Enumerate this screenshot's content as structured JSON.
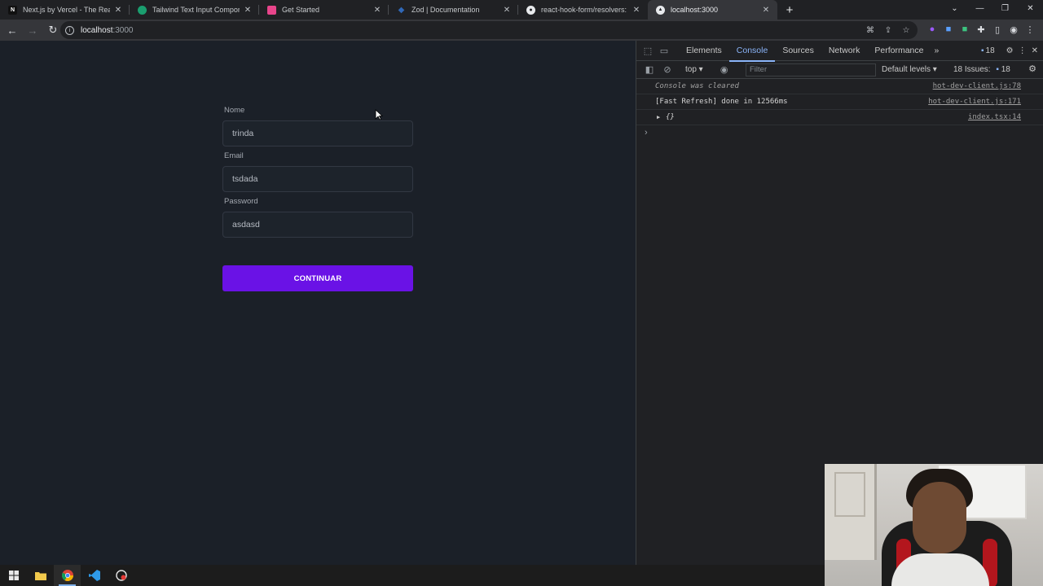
{
  "browser": {
    "tabs": [
      {
        "title": "Next.js by Vercel - The React Framework",
        "favicon": "N",
        "favicon_color": "#111111",
        "active": false
      },
      {
        "title": "Tailwind Text Input Components",
        "favicon": "",
        "favicon_color": "#1a9e6f",
        "active": false
      },
      {
        "title": "Get Started",
        "favicon": "",
        "favicon_color": "#e8458b",
        "active": false
      },
      {
        "title": "Zod | Documentation",
        "favicon": "",
        "favicon_color": "#3068b7",
        "active": false
      },
      {
        "title": "react-hook-form/resolvers: ▣ V",
        "favicon": "",
        "favicon_color": "#e8eaed",
        "active": false
      },
      {
        "title": "localhost:3000",
        "favicon": "▲",
        "favicon_color": "#202124",
        "active": true
      }
    ],
    "new_tab": "+",
    "url_host": "localhost",
    "url_port": ":3000"
  },
  "form": {
    "fields": [
      {
        "label": "Nome",
        "value": "trinda"
      },
      {
        "label": "Email",
        "value": "tsdada"
      },
      {
        "label": "Password",
        "value": "asdasd"
      }
    ],
    "submit_label": "CONTINUAR",
    "accent": "#6a12e6"
  },
  "devtools": {
    "tabs": [
      "Elements",
      "Console",
      "Sources",
      "Network",
      "Performance"
    ],
    "active_tab": "Console",
    "more": "»",
    "message_count": "18",
    "context": "top",
    "filter_placeholder": "Filter",
    "levels": "Default levels ▾",
    "issues_label": "18 Issues:",
    "issues_count": "18",
    "logs": [
      {
        "text": "Console was cleared",
        "source": "hot-dev-client.js:78",
        "kind": "cleared"
      },
      {
        "text": "[Fast Refresh] done in 12566ms",
        "source": "hot-dev-client.js:171",
        "kind": "normal"
      },
      {
        "text": "{}",
        "source": "index.tsx:14",
        "kind": "obj"
      }
    ],
    "prompt": "›"
  }
}
